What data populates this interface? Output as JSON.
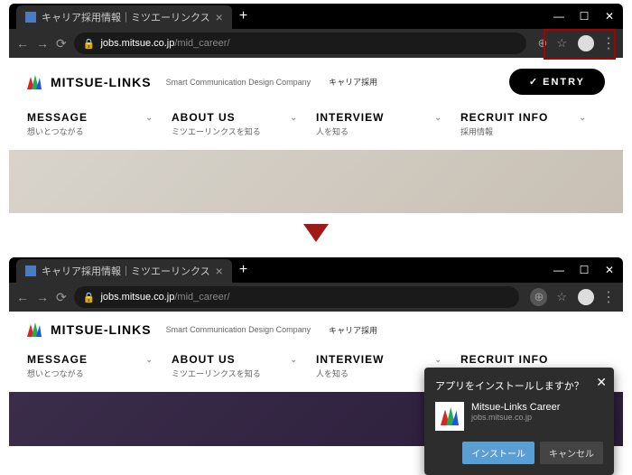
{
  "tab_title": "キャリア採用情報｜ミツエーリンクス",
  "url_domain": "jobs.mitsue.co.jp",
  "url_path": "/mid_career/",
  "brand_name": "MITSUE-LINKS",
  "tagline": "Smart Communication Design Company",
  "breadcrumb": "キャリア採用",
  "entry_label": "ENTRY",
  "nav": [
    {
      "title": "MESSAGE",
      "sub": "想いとつながる"
    },
    {
      "title": "ABOUT US",
      "sub": "ミツエーリンクスを知る"
    },
    {
      "title": "INTERVIEW",
      "sub": "人を知る"
    },
    {
      "title": "RECRUIT INFO",
      "sub": "採用情報"
    }
  ],
  "popup": {
    "title": "アプリをインストールしますか？",
    "app_name": "Mitsue-Links Career",
    "app_domain": "jobs.mitsue.co.jp",
    "install": "インストール",
    "cancel": "キャンセル"
  }
}
